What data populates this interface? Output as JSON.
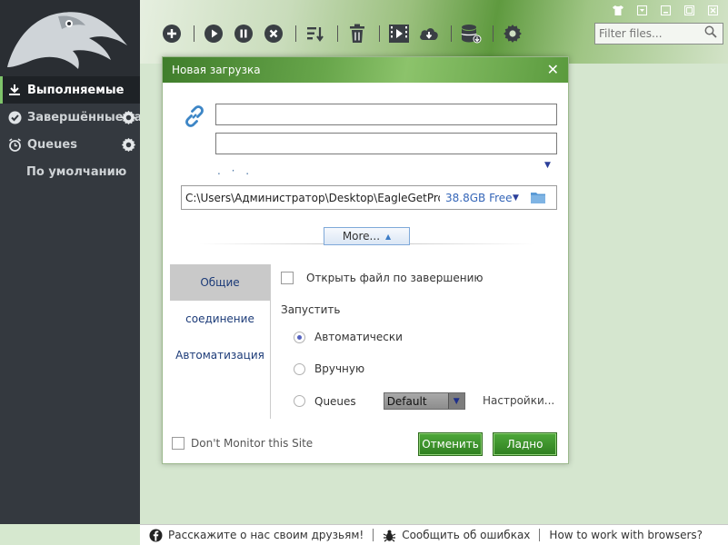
{
  "window": {
    "controls": [
      "skin-icon",
      "minimize-tray-icon",
      "minimize-icon",
      "maximize-icon",
      "close-icon"
    ]
  },
  "sidebar": {
    "items": [
      {
        "label": "Выполняемые",
        "icon": "download-icon",
        "active": true
      },
      {
        "label": "Завершённые за",
        "icon": "check-circle-icon",
        "active": false
      },
      {
        "label": "Queues",
        "icon": "alarm-clock-icon",
        "active": false
      }
    ],
    "sub_item": "По умолчанию"
  },
  "toolbar": {
    "buttons": [
      "add-icon",
      "play-icon",
      "pause-icon",
      "stop-icon",
      "sort-icon",
      "trash-icon",
      "video-icon",
      "cloud-download-icon",
      "database-icon",
      "settings-icon"
    ]
  },
  "filter": {
    "placeholder": "Filter files..."
  },
  "dialog": {
    "title": "Новая загрузка",
    "url_value": "",
    "name_value": "",
    "dots": ". · .",
    "path": "C:\\Users\\Администратор\\Desktop\\EagleGetPro",
    "free_space": "38.8GB Free",
    "more_label": "More...",
    "tabs": [
      "Общие",
      "соединение",
      "Автоматизация"
    ],
    "active_tab": 0,
    "open_on_complete": "Открыть файл по завершению",
    "start_label": "Запустить",
    "start_options": [
      "Автоматически",
      "Вручную",
      "Queues"
    ],
    "start_selected": 0,
    "queue_value": "Default",
    "settings_link": "Настройки...",
    "dont_monitor": "Don't Monitor this Site",
    "cancel_label": "Отменить",
    "ok_label": "Ладно"
  },
  "statusbar": {
    "share": "Расскажите о нас своим друзьям!",
    "report": "Сообщить об ошибках",
    "browsers": "How to work with browsers?"
  },
  "colors": {
    "sidebar_bg": "#34393f",
    "accent_green": "#3f8f2c",
    "link_blue": "#3566b8"
  }
}
